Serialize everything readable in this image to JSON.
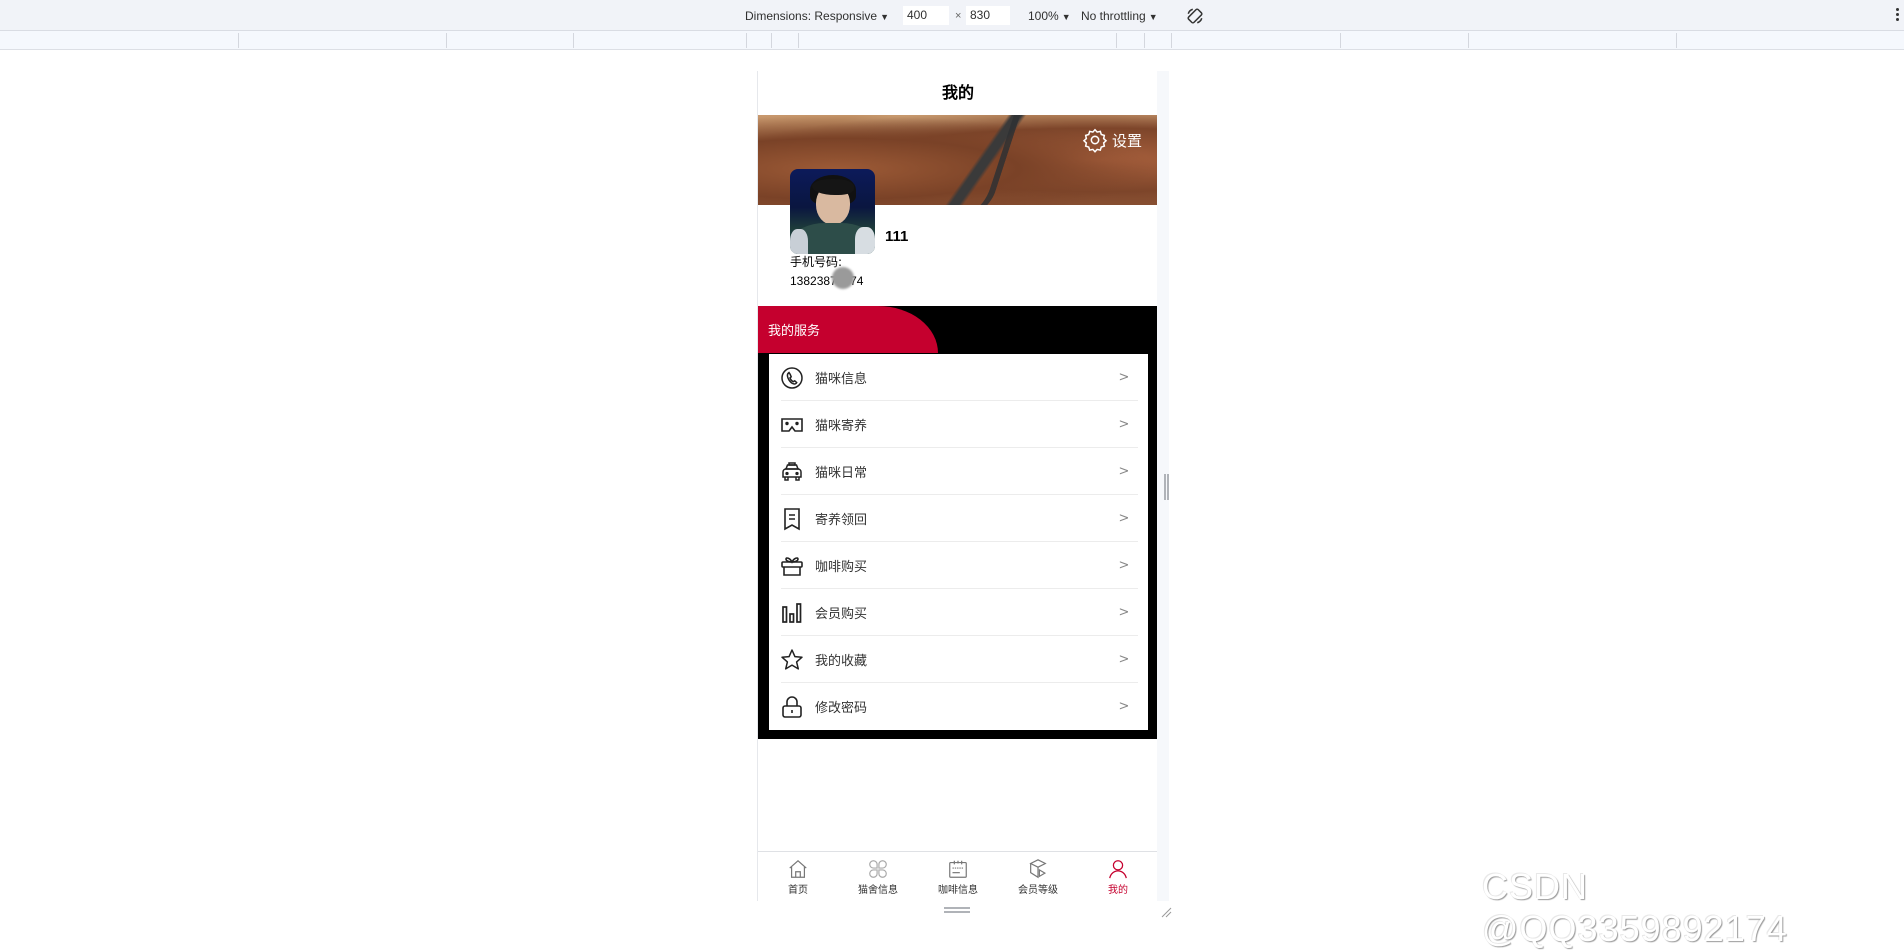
{
  "devtools": {
    "dimensions_label": "Dimensions: Responsive",
    "width": "400",
    "times": "×",
    "height": "830",
    "zoom": "100%",
    "throttling": "No throttling",
    "rotate_icon": "rotate-icon",
    "more_icon": "more-vert-icon"
  },
  "page": {
    "title": "我的",
    "settings_label": "设置",
    "user": {
      "name": "111",
      "phone_label": "手机号码:",
      "phone": "13823877774"
    },
    "service": {
      "title": "我的服务",
      "items": [
        {
          "label": "猫咪信息",
          "icon": "phone-icon"
        },
        {
          "label": "猫咪寄养",
          "icon": "vr-glasses-icon"
        },
        {
          "label": "猫咪日常",
          "icon": "taxi-icon"
        },
        {
          "label": "寄养领回",
          "icon": "receipt-icon"
        },
        {
          "label": "咖啡购买",
          "icon": "gift-icon"
        },
        {
          "label": "会员购买",
          "icon": "bar-chart-icon"
        },
        {
          "label": "我的收藏",
          "icon": "star-icon"
        },
        {
          "label": "修改密码",
          "icon": "lock-icon"
        }
      ],
      "chevron": ">"
    },
    "tabbar": [
      {
        "label": "首页",
        "icon": "home-icon",
        "active": false
      },
      {
        "label": "猫舍信息",
        "icon": "clover-icon",
        "active": false
      },
      {
        "label": "咖啡信息",
        "icon": "calendar-icon",
        "active": false
      },
      {
        "label": "会员等级",
        "icon": "cube-icon",
        "active": false
      },
      {
        "label": "我的",
        "icon": "user-icon",
        "active": true
      }
    ]
  },
  "colors": {
    "accent": "#c5002e",
    "service_bg": "#000000"
  },
  "watermark": "CSDN @QQ3359892174"
}
